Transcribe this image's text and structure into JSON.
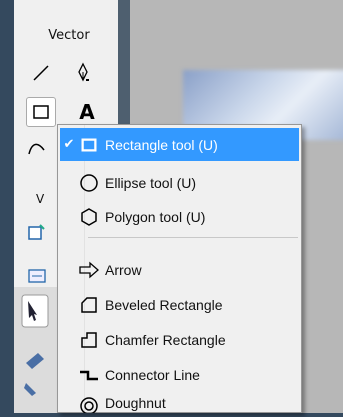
{
  "sidebar": {
    "section_title": "Vector",
    "section_title_2": "V",
    "tools": [
      {
        "name": "line-tool",
        "icon": "line-icon"
      },
      {
        "name": "pen-tool",
        "icon": "pen-icon"
      },
      {
        "name": "rectangle-tool",
        "icon": "rectangle-icon",
        "selected": true
      },
      {
        "name": "text-tool",
        "icon": "text-icon",
        "glyph": "A"
      },
      {
        "name": "freeform-tool",
        "icon": "freeform-icon"
      }
    ]
  },
  "menu": {
    "items": [
      {
        "label": "Rectangle tool (U)",
        "icon": "rectangle-icon",
        "checked": true,
        "highlight": true
      },
      {
        "label": "Ellipse tool (U)",
        "icon": "ellipse-icon"
      },
      {
        "label": "Polygon tool (U)",
        "icon": "polygon-icon"
      },
      {
        "label": "Arrow",
        "icon": "arrow-icon"
      },
      {
        "label": "Beveled Rectangle",
        "icon": "beveled-rectangle-icon"
      },
      {
        "label": "Chamfer Rectangle",
        "icon": "chamfer-rectangle-icon"
      },
      {
        "label": "Connector Line",
        "icon": "connector-line-icon"
      },
      {
        "label": "Doughnut",
        "icon": "doughnut-icon"
      }
    ],
    "highlight_color": "#3399ff"
  }
}
